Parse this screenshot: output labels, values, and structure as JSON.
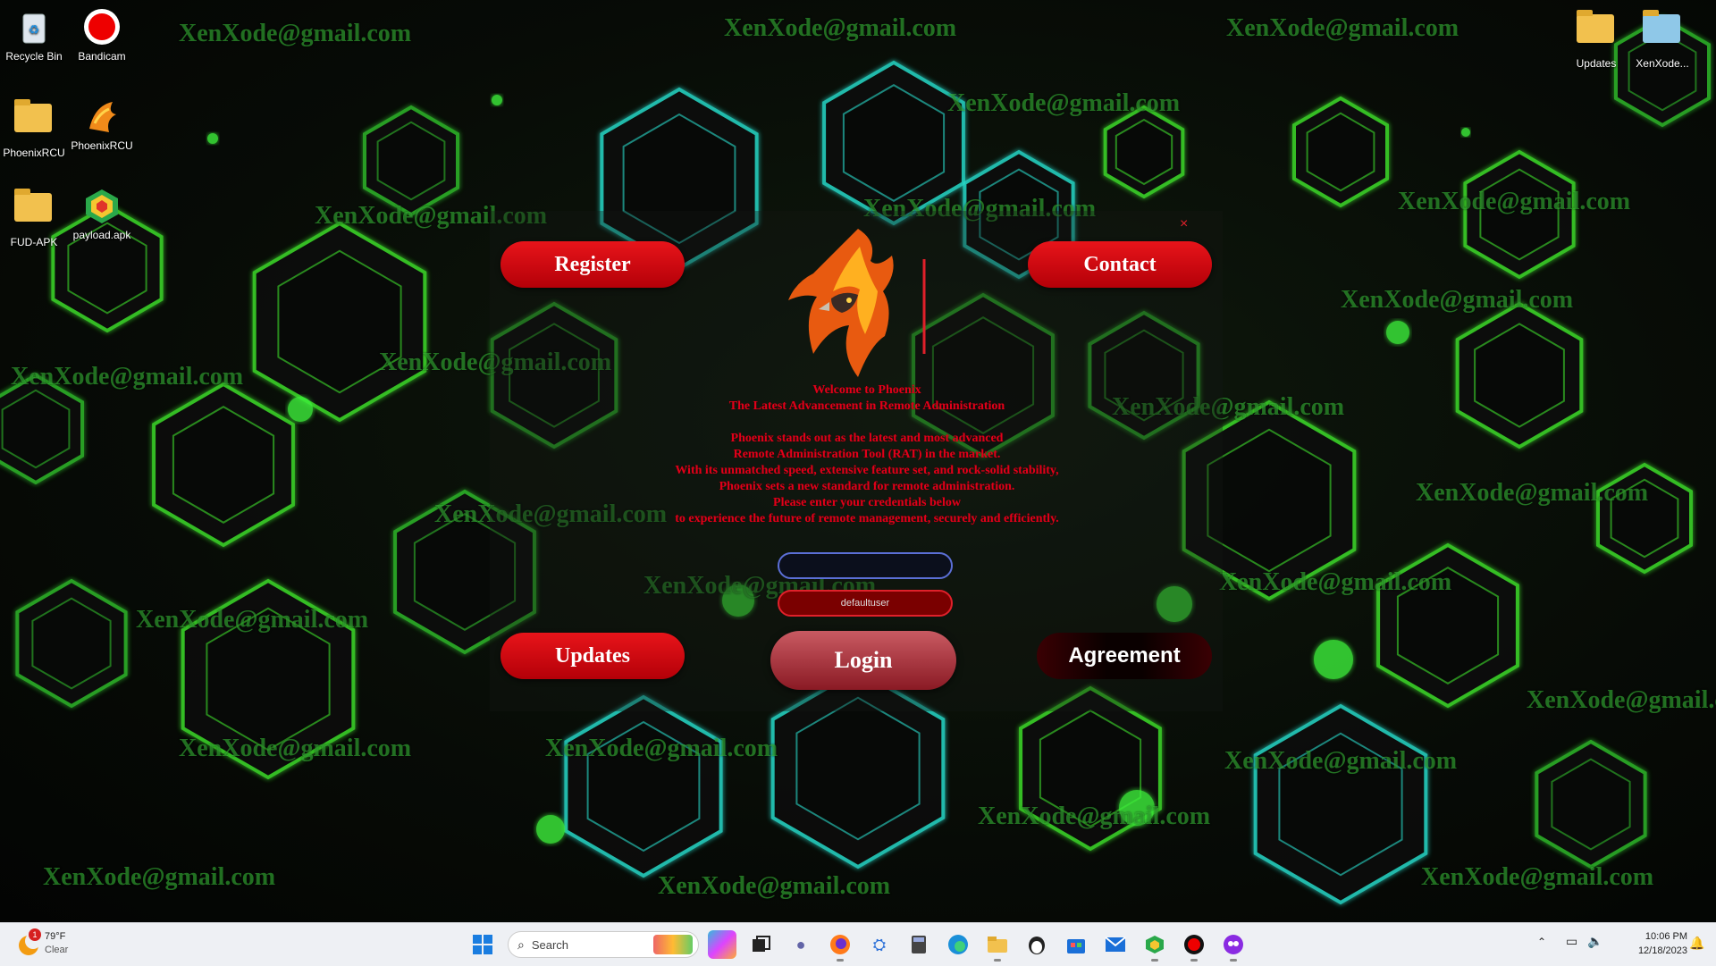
{
  "watermark_text": "XenXode@gmail.com",
  "desktop_icons": [
    {
      "label": "Recycle Bin",
      "icon": "recycle-bin-icon"
    },
    {
      "label": "Bandicam",
      "icon": "bandicam-icon"
    },
    {
      "label": "PhoenixRCU",
      "icon": "folder-icon"
    },
    {
      "label": "PhoenixRCU",
      "icon": "phoenix-icon"
    },
    {
      "label": "FUD-APK",
      "icon": "folder-icon"
    },
    {
      "label": "payload.apk",
      "icon": "bluestacks-icon"
    },
    {
      "label": "Updates",
      "icon": "folder-icon"
    },
    {
      "label": "XenXode...",
      "icon": "folder-icon"
    }
  ],
  "app": {
    "buttons": {
      "register": "Register",
      "contact": "Contact",
      "updates": "Updates",
      "login": "Login",
      "agreement": "Agreement"
    },
    "close_glyph": "×",
    "welcome_lines": [
      "Welcome to Phoenix",
      "The Latest Advancement in Remote Administration",
      "",
      "Phoenix stands out as the latest and most advanced",
      "Remote Administration Tool (RAT) in the market.",
      "With its unmatched speed, extensive feature set, and rock-solid stability,",
      "Phoenix sets a new standard for remote administration.",
      "Please enter your credentials below",
      "to experience the future of remote management, securely and efficiently."
    ],
    "username_value": "",
    "password_value": "defaultuser"
  },
  "taskbar": {
    "weather": {
      "temp": "79°F",
      "condition": "Clear",
      "badge": "1"
    },
    "search_placeholder": "Search",
    "time": "10:06 PM",
    "date": "12/18/2023"
  },
  "colors": {
    "accent_red": "#e8141a",
    "hex_green": "#3ddc2a",
    "hex_cyan": "#28d8c8"
  }
}
